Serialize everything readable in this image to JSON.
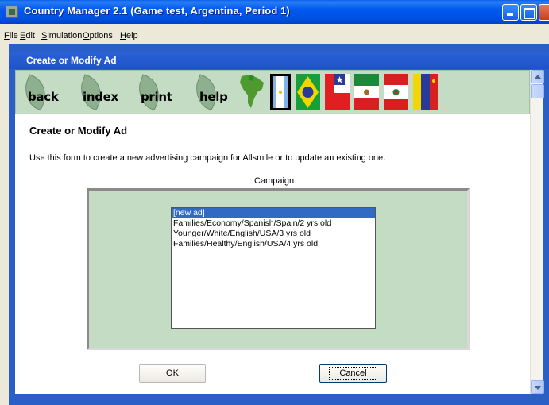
{
  "window": {
    "title": "Country Manager 2.1 (Game test, Argentina, Period 1)"
  },
  "menu": [
    {
      "label": "File",
      "accel": "F",
      "rest": "ile"
    },
    {
      "label": "Edit",
      "accel": "E",
      "rest": "dit"
    },
    {
      "label": "Simulation",
      "accel": "S",
      "rest": "imulation"
    },
    {
      "label": "Options",
      "accel": "O",
      "rest": "ptions"
    },
    {
      "label": "Help",
      "accel": "H",
      "rest": "elp"
    }
  ],
  "subwindow": {
    "title": "Create or Modify Ad"
  },
  "toolbar": {
    "nav": [
      {
        "id": "back",
        "label": "back"
      },
      {
        "id": "index",
        "label": "index"
      },
      {
        "id": "print",
        "label": "print"
      },
      {
        "id": "help",
        "label": "help"
      }
    ],
    "flags": [
      "south-america-map-icon",
      "argentina-flag-icon",
      "brazil-flag-icon",
      "chile-flag-icon",
      "mexico-flag-icon",
      "peru-flag-icon",
      "venezuela-flag-icon"
    ]
  },
  "page": {
    "heading": "Create or Modify Ad",
    "description": "Use this form to create a new advertising campaign for Allsmile or to update an existing one."
  },
  "campaign": {
    "label": "Campaign",
    "selected_index": 0,
    "items": [
      "[new ad]",
      "Families/Economy/Spanish/Spain/2 yrs old",
      "Younger/White/English/USA/3 yrs old",
      "Families/Healthy/English/USA/4 yrs old"
    ]
  },
  "buttons": {
    "ok": "OK",
    "cancel": "Cancel"
  },
  "colors": {
    "titlebar": "#0054e3",
    "panel_green": "#c4dbc4",
    "selection": "#316ac5"
  }
}
